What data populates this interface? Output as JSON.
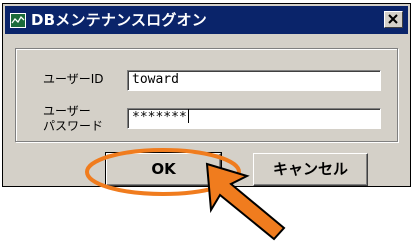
{
  "window": {
    "title": "DBメンテナンスログオン",
    "icon": "app-window-icon",
    "close_icon": "close-icon"
  },
  "form": {
    "user_id_label": "ユーザーID",
    "user_id_value": "toward",
    "password_label_line1": "ユーザー",
    "password_label_line2": "パスワード",
    "password_value": "*******"
  },
  "buttons": {
    "ok_label": "OK",
    "cancel_label": "キャンセル"
  },
  "annotation": {
    "highlight_color": "#f07c1e",
    "arrow_color": "#f07c1e"
  }
}
